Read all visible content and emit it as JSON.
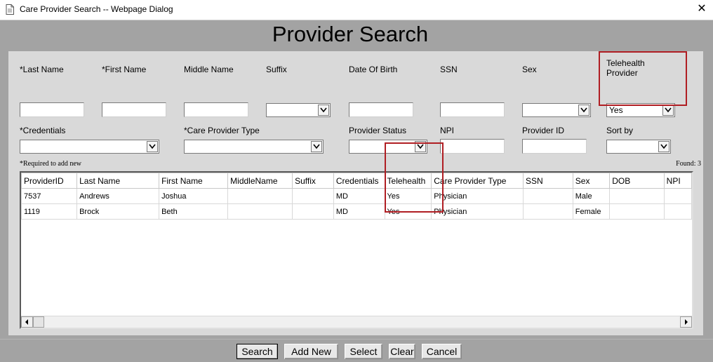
{
  "window": {
    "title": "Care Provider Search -- Webpage Dialog",
    "close_glyph": "✕"
  },
  "page": {
    "heading": "Provider Search"
  },
  "form": {
    "last_name": {
      "label": "*Last Name",
      "value": ""
    },
    "first_name": {
      "label": "*First Name",
      "value": ""
    },
    "middle_name": {
      "label": "Middle Name",
      "value": ""
    },
    "suffix": {
      "label": "Suffix",
      "value": ""
    },
    "dob": {
      "label": "Date Of Birth",
      "value": ""
    },
    "ssn": {
      "label": "SSN",
      "value": ""
    },
    "sex": {
      "label": "Sex",
      "value": ""
    },
    "telehealth": {
      "label": "Telehealth Provider",
      "value": "Yes"
    },
    "credentials": {
      "label": "*Credentials",
      "value": ""
    },
    "care_provider_type": {
      "label": "*Care Provider Type",
      "value": ""
    },
    "provider_status": {
      "label": "Provider Status",
      "value": ""
    },
    "npi": {
      "label": "NPI",
      "value": ""
    },
    "provider_id": {
      "label": "Provider ID",
      "value": ""
    },
    "sort_by": {
      "label": "Sort by",
      "value": ""
    }
  },
  "notes": {
    "required": "*Required to add new",
    "found": "Found: 3"
  },
  "results": {
    "columns": [
      "ProviderID",
      "Last Name",
      "First Name",
      "MiddleName",
      "Suffix",
      "Credentials",
      "Telehealth",
      "Care Provider Type",
      "SSN",
      "Sex",
      "DOB",
      "NPI"
    ],
    "rows": [
      [
        "7537",
        "Andrews",
        "Joshua",
        "",
        "",
        "MD",
        "Yes",
        "Physician",
        "",
        "Male",
        "",
        ""
      ],
      [
        "1119",
        "Brock",
        "Beth",
        "",
        "",
        "MD",
        "Yes",
        "Physician",
        "",
        "Female",
        "",
        ""
      ]
    ]
  },
  "buttons": {
    "search": "Search",
    "add_new": "Add New",
    "select": "Select",
    "clear": "Clear",
    "cancel": "Cancel"
  },
  "colors": {
    "highlight": "#b01e23",
    "dialog_bg": "#a3a3a3",
    "panel_bg": "#d9d9d9"
  }
}
